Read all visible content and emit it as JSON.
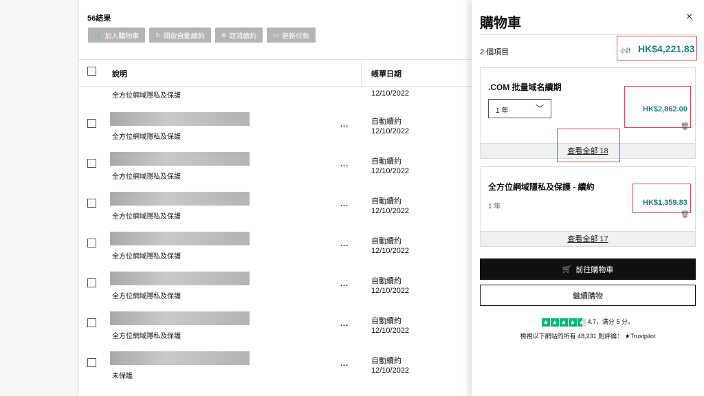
{
  "main": {
    "results_count": "56結果",
    "toolbar": [
      {
        "icon": "cart-icon",
        "glyph": "🛒",
        "label": "加入購物車"
      },
      {
        "icon": "refresh-icon",
        "glyph": "↻",
        "label": "開啟自動續約"
      },
      {
        "icon": "cancel-icon",
        "glyph": "⊗",
        "label": "取消續約"
      },
      {
        "icon": "card-icon",
        "glyph": "▭",
        "label": "更新付款"
      }
    ],
    "table": {
      "headers": {
        "description": "說明",
        "billing_date": "帳單日期"
      },
      "first_row": {
        "description": "全方位網域隱私及保護",
        "date": "12/10/2022"
      },
      "rows": [
        {
          "description": "全方位網域隱私及保護",
          "status": "自動續約",
          "date": "12/10/2022"
        },
        {
          "description": "全方位網域隱私及保護",
          "status": "自動續約",
          "date": "12/10/2022"
        },
        {
          "description": "全方位網域隱私及保護",
          "status": "自動續約",
          "date": "12/10/2022"
        },
        {
          "description": "全方位網域隱私及保護",
          "status": "自動續約",
          "date": "12/10/2022"
        },
        {
          "description": "全方位網域隱私及保護",
          "status": "自動續約",
          "date": "12/10/2022"
        },
        {
          "description": "全方位網域隱私及保護",
          "status": "自動續約",
          "date": "12/10/2022"
        },
        {
          "description": "未保護",
          "status": "自動續約",
          "date": "12/10/2022"
        }
      ],
      "more_label": "..."
    }
  },
  "cart": {
    "title": "購物車",
    "close": "×",
    "item_count": "2 個項目",
    "subtotal_label": "小計:",
    "subtotal": "HK$4,221.83",
    "items": [
      {
        "title": ".COM 批量域名續期",
        "term": "1 年",
        "price": "HK$2,862.00",
        "view_all": "查看全部 18"
      },
      {
        "title": "全方位網域隱私及保護 - 續約",
        "term": "1 年",
        "price": "HK$1,359.83",
        "view_all": "查看全部 17"
      }
    ],
    "checkout_label": "前往購物車",
    "continue_label": "繼續購物",
    "trustpilot": {
      "rating_text": "4.7，滿分 5 分。",
      "reviews_text": "檢視以下網站的所有 48,231 則評論：",
      "brand": "★Trustpilot",
      "star_color": "#00b67a"
    },
    "accent_color": "#1f7f7f"
  }
}
